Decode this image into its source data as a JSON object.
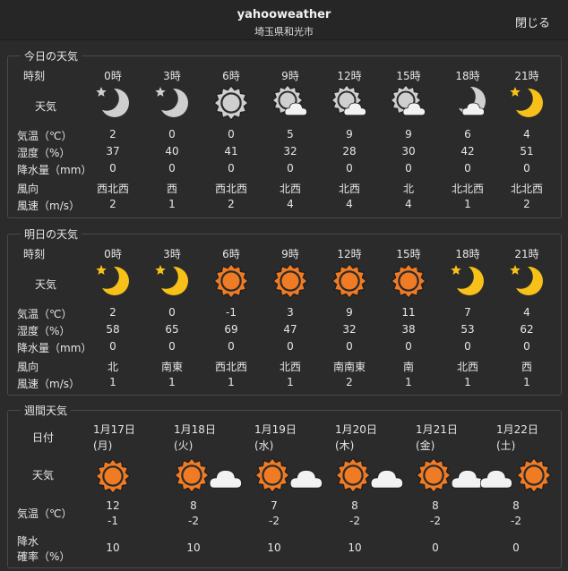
{
  "window": {
    "title": "yahooweather",
    "subtitle": "埼玉県和光市",
    "close_label": "閉じる"
  },
  "labels": {
    "time": "時刻",
    "weather": "天気",
    "temp": "気温（℃）",
    "humidity": "湿度（%）",
    "precip": "降水量（mm）",
    "wind_dir": "風向",
    "wind_speed": "風速（m/s）",
    "date": "日付",
    "weekly_temp": "気温（℃）",
    "rain_prob_1": "降水",
    "rain_prob_2": "確率（%）"
  },
  "today": {
    "title": "今日の天気",
    "hours": [
      "0時",
      "3時",
      "6時",
      "9時",
      "12時",
      "15時",
      "18時",
      "21時"
    ],
    "icons": [
      "moon-star-icon",
      "moon-star-icon",
      "sun-icon",
      "sun-cloud-icon",
      "sun-cloud-icon",
      "sun-cloud-icon",
      "moon-cloud-icon",
      "moon-star-icon"
    ],
    "icon_variant": [
      "gray",
      "gray",
      "gray",
      "gray",
      "gray",
      "gray",
      "gray",
      "yellow"
    ],
    "temp": [
      "2",
      "0",
      "0",
      "5",
      "9",
      "9",
      "6",
      "4"
    ],
    "humidity": [
      "37",
      "40",
      "41",
      "32",
      "28",
      "30",
      "42",
      "51"
    ],
    "precip": [
      "0",
      "0",
      "0",
      "0",
      "0",
      "0",
      "0",
      "0"
    ],
    "wind_dir": [
      "西北西",
      "西",
      "西北西",
      "北西",
      "北西",
      "北",
      "北北西",
      "北北西"
    ],
    "wind_speed": [
      "2",
      "1",
      "2",
      "4",
      "4",
      "4",
      "1",
      "2"
    ]
  },
  "tomorrow": {
    "title": "明日の天気",
    "hours": [
      "0時",
      "3時",
      "6時",
      "9時",
      "12時",
      "15時",
      "18時",
      "21時"
    ],
    "icons": [
      "moon-star-icon",
      "moon-star-icon",
      "sun-icon",
      "sun-icon",
      "sun-icon",
      "sun-icon",
      "moon-star-icon",
      "moon-star-icon"
    ],
    "icon_variant": [
      "yellow",
      "yellow",
      "orange",
      "orange",
      "orange",
      "orange",
      "yellow",
      "yellow"
    ],
    "temp": [
      "2",
      "0",
      "-1",
      "3",
      "9",
      "11",
      "7",
      "4"
    ],
    "humidity": [
      "58",
      "65",
      "69",
      "47",
      "32",
      "38",
      "53",
      "62"
    ],
    "precip": [
      "0",
      "0",
      "0",
      "0",
      "0",
      "0",
      "0",
      "0"
    ],
    "wind_dir": [
      "北",
      "南東",
      "西北西",
      "北西",
      "南南東",
      "南",
      "北西",
      "西"
    ],
    "wind_speed": [
      "1",
      "1",
      "1",
      "1",
      "2",
      "1",
      "1",
      "1"
    ]
  },
  "weekly": {
    "title": "週間天気",
    "dates": [
      "1月17日",
      "1月18日",
      "1月19日",
      "1月20日",
      "1月21日",
      "1月22日"
    ],
    "weekdays": [
      "(月)",
      "(火)",
      "(水)",
      "(木)",
      "(金)",
      "(土)"
    ],
    "icons": [
      "sun-icon",
      "sun-then-cloud-icon",
      "sun-then-cloud-icon",
      "sun-then-cloud-icon",
      "sun-then-cloud-icon",
      "cloud-then-sun-icon"
    ],
    "high": [
      "12",
      "8",
      "7",
      "8",
      "8",
      "8"
    ],
    "low": [
      "-1",
      "-2",
      "-2",
      "-2",
      "-2",
      "-2"
    ],
    "rain_prob": [
      "10",
      "10",
      "10",
      "10",
      "0",
      "0"
    ]
  },
  "colors": {
    "sun_orange": "#f07b25",
    "moon_yellow": "#f7c11a",
    "gray_icon": "#cfcfcf",
    "cloud_white": "#f2f2f2",
    "background": "#2b2b2b"
  }
}
